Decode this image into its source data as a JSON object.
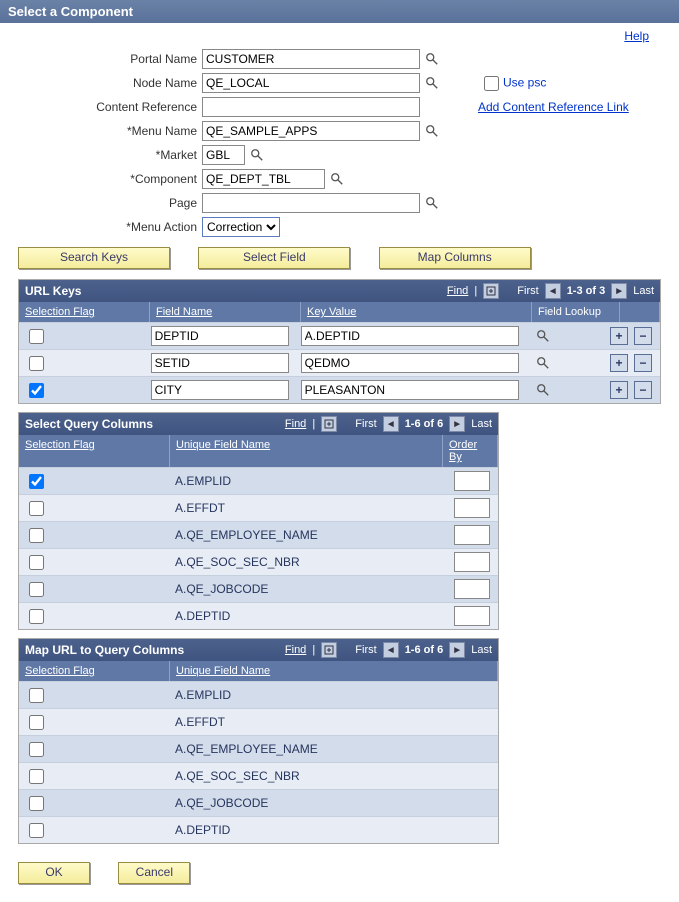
{
  "title": "Select a Component",
  "help": "Help",
  "form": {
    "portal_name": {
      "label": "Portal Name",
      "value": "CUSTOMER"
    },
    "node_name": {
      "label": "Node Name",
      "value": "QE_LOCAL"
    },
    "content_ref": {
      "label": "Content Reference",
      "value": ""
    },
    "menu_name": {
      "label": "Menu Name",
      "value": "QE_SAMPLE_APPS"
    },
    "market": {
      "label": "Market",
      "value": "GBL"
    },
    "component": {
      "label": "Component",
      "value": "QE_DEPT_TBL"
    },
    "page": {
      "label": "Page",
      "value": ""
    },
    "menu_action": {
      "label": "Menu Action",
      "value": "Correction"
    },
    "use_psc": "Use psc",
    "add_link": "Add Content Reference Link"
  },
  "buttons": {
    "search_keys": "Search Keys",
    "select_field": "Select Field",
    "map_columns": "Map Columns",
    "ok": "OK",
    "cancel": "Cancel"
  },
  "grid_common": {
    "find": "Find",
    "first": "First",
    "last": "Last"
  },
  "url_keys": {
    "title": "URL Keys",
    "range": "1-3 of 3",
    "headers": {
      "sel": "Selection Flag",
      "fn": "Field Name",
      "kv": "Key Value",
      "fl": "Field Lookup"
    },
    "rows": [
      {
        "checked": false,
        "field": "DEPTID",
        "key": "A.DEPTID"
      },
      {
        "checked": false,
        "field": "SETID",
        "key": "QEDMO"
      },
      {
        "checked": true,
        "field": "CITY",
        "key": "PLEASANTON"
      }
    ]
  },
  "select_cols": {
    "title": "Select Query Columns",
    "range": "1-6 of 6",
    "headers": {
      "sel": "Selection Flag",
      "ufn": "Unique Field Name",
      "ob": "Order By"
    },
    "rows": [
      {
        "checked": true,
        "name": "A.EMPLID"
      },
      {
        "checked": false,
        "name": "A.EFFDT"
      },
      {
        "checked": false,
        "name": "A.QE_EMPLOYEE_NAME"
      },
      {
        "checked": false,
        "name": "A.QE_SOC_SEC_NBR"
      },
      {
        "checked": false,
        "name": "A.QE_JOBCODE"
      },
      {
        "checked": false,
        "name": "A.DEPTID"
      }
    ]
  },
  "map_cols": {
    "title": "Map URL to Query Columns",
    "range": "1-6 of 6",
    "headers": {
      "sel": "Selection Flag",
      "ufn": "Unique Field Name"
    },
    "rows": [
      {
        "checked": false,
        "name": "A.EMPLID"
      },
      {
        "checked": false,
        "name": "A.EFFDT"
      },
      {
        "checked": false,
        "name": "A.QE_EMPLOYEE_NAME"
      },
      {
        "checked": false,
        "name": "A.QE_SOC_SEC_NBR"
      },
      {
        "checked": false,
        "name": "A.QE_JOBCODE"
      },
      {
        "checked": false,
        "name": "A.DEPTID"
      }
    ]
  }
}
